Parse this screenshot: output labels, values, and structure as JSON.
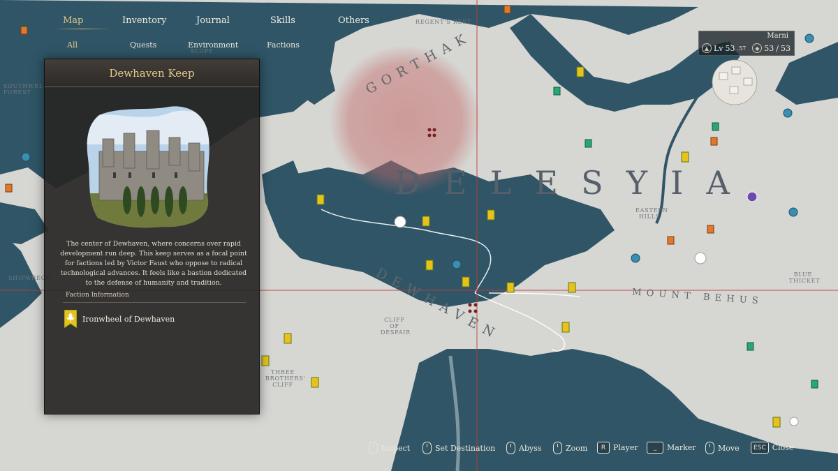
{
  "nav": {
    "tabs": [
      "Map",
      "Inventory",
      "Journal",
      "Skills",
      "Others"
    ],
    "active_tab": "Map",
    "subtabs": [
      "All",
      "Quests",
      "Environment",
      "Factions"
    ],
    "active_subtab": "All"
  },
  "player": {
    "name": "Marni",
    "lv_label": "Lv",
    "level": "53",
    "level_fraction": ".57",
    "ability_current": "53",
    "ability_max": "53",
    "ability_sep": "/"
  },
  "panel": {
    "title": "Dewhaven Keep",
    "description": "The center of Dewhaven, where concerns over rapid development run deep. This keep serves as a focal point for factions led by Victor Faust who oppose to radical technological advances. It feels like a bastion dedicated to the defense of humanity and tradition.",
    "faction_header": "Faction Information",
    "faction_name": "Ironwheel of Dewhaven",
    "faction_color": "#e8c21a"
  },
  "map": {
    "regions": [
      "DELESYIA",
      "GORTHAK",
      "DEWHAVEN",
      "MOUNT BEHUS"
    ],
    "places": [
      "REGENT'S REST",
      "EASTERN HILLS",
      "BLUE THICKET",
      "CLIFF OF DESPAIR",
      "THREE BROTHERS' CLIFF",
      "SOUTHWELL FOREST",
      "SLOPE",
      "SHIPWRECK"
    ],
    "danger_zone_color": "#c46a6a",
    "crosshair_color": "#c23b3b",
    "sea_color": "#2f5566",
    "land_color": "#d6d6d2"
  },
  "hints": [
    {
      "icon": "mouse-icon",
      "label": "Inspect"
    },
    {
      "icon": "mouse-icon",
      "label": "Set Destination"
    },
    {
      "icon": "mouse-icon",
      "label": "Abyss"
    },
    {
      "icon": "mouse-icon",
      "label": "Zoom"
    },
    {
      "key": "R",
      "label": "Player"
    },
    {
      "key": "",
      "label": "Marker"
    },
    {
      "icon": "mouse-icon",
      "label": "Move"
    },
    {
      "key": "ESC",
      "label": "Close"
    }
  ]
}
